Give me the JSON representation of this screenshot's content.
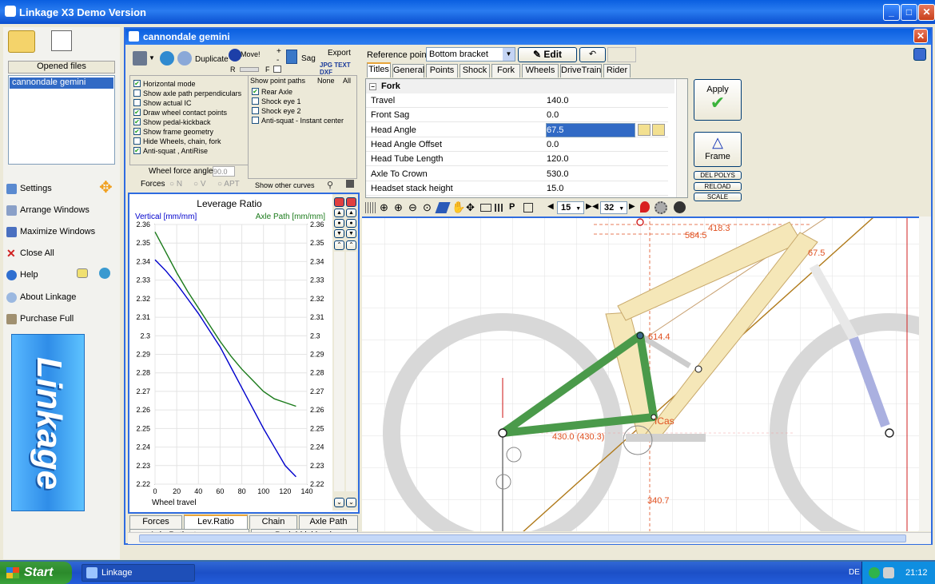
{
  "window": {
    "title": "Linkage X3 Demo Version"
  },
  "left": {
    "opened_files_label": "Opened files",
    "files": [
      "cannondale gemini"
    ],
    "menu": [
      "Settings",
      "Arrange Windows",
      "Maximize Windows",
      "Close All",
      "Help",
      "About Linkage",
      "Purchase Full"
    ],
    "logo_text": "Linkage"
  },
  "doc": {
    "title": "cannondale gemini"
  },
  "toolbar": {
    "duplicate": "Duplicate",
    "move": "Move!",
    "r": "R",
    "f": "F",
    "plus": "+",
    "minus": "-",
    "sag": "Sag",
    "export": "Export",
    "export_formats": "JPG TEXT DXF"
  },
  "options": {
    "checks": [
      {
        "label": "Horizontal mode",
        "on": true
      },
      {
        "label": "Show axle path perpendiculars",
        "on": false
      },
      {
        "label": "Show actual IC",
        "on": false
      },
      {
        "label": "Draw wheel contact points",
        "on": true
      },
      {
        "label": "Show pedal-kickback",
        "on": true
      },
      {
        "label": "Show frame geometry",
        "on": true
      },
      {
        "label": "Hide Wheels, chain, fork",
        "on": false
      },
      {
        "label": "Anti-squat , AntiRise",
        "on": true
      }
    ],
    "paths_label": "Show point paths",
    "none": "None",
    "all": "All",
    "paths": [
      {
        "label": "Rear Axle",
        "on": true
      },
      {
        "label": "Shock eye 1",
        "on": false
      },
      {
        "label": "Shock eye 2",
        "on": false
      },
      {
        "label": "Anti-squat - Instant center",
        "on": false
      }
    ],
    "wheel_force_angle_label": "Wheel force angle",
    "wheel_force_angle": "90.0",
    "forces_label": "Forces",
    "forces": [
      "N",
      "V",
      "APT"
    ],
    "other_curves": "Show other curves"
  },
  "chart_data": {
    "type": "line",
    "title": "Leverage Ratio",
    "xlabel": "Wheel travel",
    "ylabel_left": "Vertical [mm/mm]",
    "ylabel_right": "Axle Path [mm/mm]",
    "xlim": [
      0,
      140
    ],
    "ylim": [
      2.22,
      2.36
    ],
    "xticks": [
      "0",
      "20",
      "40",
      "60",
      "80",
      "100",
      "120",
      "140"
    ],
    "yticks": [
      "2.22",
      "2.23",
      "2.24",
      "2.25",
      "2.26",
      "2.27",
      "2.28",
      "2.29",
      "2.3",
      "2.31",
      "2.32",
      "2.33",
      "2.34",
      "2.35",
      "2.36"
    ],
    "series": [
      {
        "name": "Vertical [mm/mm]",
        "color": "#0000cc",
        "x": [
          0,
          10,
          20,
          30,
          40,
          50,
          60,
          70,
          80,
          90,
          100,
          110,
          120,
          130
        ],
        "y": [
          2.341,
          2.335,
          2.328,
          2.32,
          2.312,
          2.303,
          2.294,
          2.283,
          2.272,
          2.261,
          2.25,
          2.24,
          2.23,
          2.224
        ]
      },
      {
        "name": "Axle Path [mm/mm]",
        "color": "#1a7a1a",
        "x": [
          0,
          10,
          20,
          30,
          40,
          50,
          60,
          70,
          80,
          90,
          100,
          110,
          120,
          130
        ],
        "y": [
          2.356,
          2.345,
          2.334,
          2.324,
          2.315,
          2.306,
          2.297,
          2.289,
          2.282,
          2.276,
          2.27,
          2.266,
          2.264,
          2.262
        ]
      }
    ]
  },
  "chart_tabs": [
    "Forces",
    "Lev.Ratio",
    "Chain",
    "Axle Path",
    "Axle Path steepness",
    "Pedal-kickback"
  ],
  "props": {
    "reference_label": "Reference point",
    "reference": "Bottom bracket",
    "edit": "Edit",
    "tabs": [
      "Titles",
      "General",
      "Points",
      "Shock",
      "Fork",
      "Wheels",
      "DriveTrain",
      "Rider"
    ],
    "section": "Fork",
    "rows": [
      {
        "k": "Travel",
        "v": "140.0"
      },
      {
        "k": "Front Sag",
        "v": "0.0"
      },
      {
        "k": "Head Angle",
        "v": "67.5"
      },
      {
        "k": "Head Angle Offset",
        "v": "0.0"
      },
      {
        "k": "Head Tube Length",
        "v": "120.0"
      },
      {
        "k": "Axle To Crown",
        "v": "530.0"
      },
      {
        "k": "Headset stack height",
        "v": "15.0"
      }
    ],
    "apply": "Apply",
    "frame": "Frame",
    "del_polys": "DEL POLYS",
    "reload": "RELOAD",
    "scale": "SCALE"
  },
  "canvas_toolbar": {
    "zoom1": "15",
    "zoom2": "32"
  },
  "drawing": {
    "dims": [
      "418.3",
      "584.5",
      "67.5",
      "614.4",
      "430.0 (430.3)",
      "ICas",
      "340.7"
    ]
  },
  "taskbar": {
    "start": "Start",
    "item": "Linkage",
    "lang": "DE",
    "time": "21:12"
  }
}
